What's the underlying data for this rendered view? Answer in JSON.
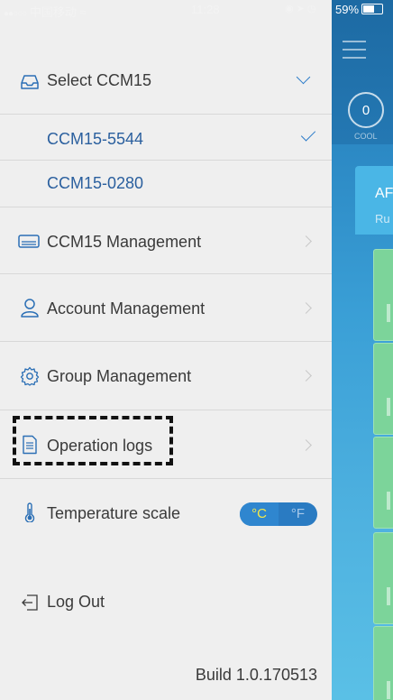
{
  "status_bar": {
    "carrier": "中国移动",
    "signal_dots": "●●○○○",
    "time": "11:28",
    "battery_percent": "59%"
  },
  "background_app": {
    "mode_value": "0",
    "mode_label": "COOL",
    "panel_title": "AF",
    "panel_sub": "Ru"
  },
  "drawer": {
    "select": {
      "label": "Select CCM15",
      "icon": "inbox-icon"
    },
    "devices": [
      {
        "label": "CCM15-5544",
        "selected": true
      },
      {
        "label": "CCM15-0280",
        "selected": false
      }
    ],
    "menu": [
      {
        "label": "CCM15 Management",
        "icon": "ac-unit-icon"
      },
      {
        "label": "Account Management",
        "icon": "user-icon"
      },
      {
        "label": "Group Management",
        "icon": "gear-icon"
      },
      {
        "label": "Operation logs",
        "icon": "document-icon"
      }
    ],
    "temperature": {
      "label": "Temperature scale",
      "celsius": "°C",
      "fahrenheit": "°F",
      "selected": "°C"
    },
    "logout": "Log Out",
    "build": "Build 1.0.170513"
  },
  "colors": {
    "accent": "#2b7bc9",
    "toggle_active_text": "#f5e94a",
    "drawer_bg": "#efefef"
  }
}
